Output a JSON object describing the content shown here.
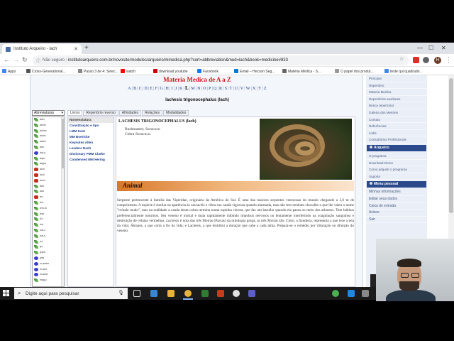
{
  "browser": {
    "tab_title": "Instituto Arqueiro - lach",
    "not_secure": "Não seguro",
    "url": "institutoarqueiro.com.br/novosite/modules/arqueiro/mmedica.php?sort=abbreviation&med=lach&book=medicine#833",
    "profile_initial": "H"
  },
  "bookmarks": [
    {
      "label": "Apps",
      "color": "#4285f4"
    },
    {
      "label": "Cross-Generational...",
      "color": "#555"
    },
    {
      "label": "Passo 3 de 4: Selec...",
      "color": "#888"
    },
    {
      "label": "watch",
      "color": "#ff0000"
    },
    {
      "label": "download youtube",
      "color": "#c00"
    },
    {
      "label": "Facebook",
      "color": "#1877f2"
    },
    {
      "label": "Email – Hecson Seg...",
      "color": "#0078d4"
    },
    {
      "label": "Matéria Médica - S...",
      "color": "#666"
    },
    {
      "label": "O papel dos produt...",
      "color": "#999"
    },
    {
      "label": "teste qui quadrado...",
      "color": "#4285f4"
    }
  ],
  "site": {
    "title": "Materia Medica de A a Z",
    "alphabet": [
      "A",
      "B",
      "C",
      "D",
      "E",
      "F",
      "G",
      "H",
      "I",
      "J",
      "K",
      "L",
      "M",
      "N",
      "O",
      "P",
      "Q",
      "R",
      "S",
      "T",
      "U",
      "V",
      "W",
      "X",
      "Y",
      "Z"
    ],
    "current_letter": "L",
    "remedy_heading": "lachesis trigonocephalus (lach)"
  },
  "select": {
    "value": "Abreviaturas"
  },
  "tabs": [
    "Livros",
    "Repertório reverso",
    "Afinidades",
    "Relações",
    "Modalidades"
  ],
  "remedy_list": [
    {
      "label": "lach",
      "icon": "leaf"
    },
    {
      "label": "lachn",
      "icon": "leaf"
    },
    {
      "label": "lachm",
      "icon": "leaf"
    },
    {
      "label": "lachs",
      "icon": "leaf"
    },
    {
      "label": "lactm",
      "icon": "leaf"
    },
    {
      "label": "lam",
      "icon": "leaf"
    },
    {
      "label": "lap-a",
      "icon": "gem"
    },
    {
      "label": "lapa",
      "icon": "leaf"
    },
    {
      "label": "lappa",
      "icon": "leaf"
    },
    {
      "label": "lat-h",
      "icon": "butterfly"
    },
    {
      "label": "lat-k",
      "icon": "butterfly"
    },
    {
      "label": "lat-m",
      "icon": "butterfly"
    },
    {
      "label": "lath",
      "icon": "leaf"
    },
    {
      "label": "laur",
      "icon": "leaf"
    },
    {
      "label": "lec",
      "icon": "butterfly"
    },
    {
      "label": "led",
      "icon": "leaf"
    },
    {
      "label": "lem-m",
      "icon": "leaf"
    },
    {
      "label": "lept",
      "icon": "leaf"
    },
    {
      "label": "lil-t",
      "icon": "leaf"
    },
    {
      "label": "lob",
      "icon": "leaf"
    },
    {
      "label": "lob-c",
      "icon": "leaf"
    },
    {
      "label": "lob-s",
      "icon": "leaf"
    },
    {
      "label": "lol",
      "icon": "leaf"
    },
    {
      "label": "lyc",
      "icon": "leaf"
    },
    {
      "label": "lycps",
      "icon": "leaf"
    },
    {
      "label": "lyss",
      "icon": "gem"
    },
    {
      "label": "m-ambo",
      "icon": "gem"
    },
    {
      "label": "m-arct",
      "icon": "gem"
    },
    {
      "label": "m-aust",
      "icon": "gem"
    },
    {
      "label": "mag-c",
      "icon": "leaf"
    }
  ],
  "menu": [
    "Nomenclatura",
    "Constituição e tipo",
    "LMM Kent",
    "MM Boericke",
    "Keynotes Allen",
    "Leaders Nash",
    "Dictionary PMM Clarke",
    "Condensed MM Hering"
  ],
  "article": {
    "title": "LACHESIS TRIGONOCEPHALUS (lach)",
    "common_names": [
      "Bushmaster; Surucucu",
      "Cobra Surucucu."
    ],
    "section": "Animal",
    "body_1": "Serpente pertencente à família das Viperidae, originária da América do Sul. É uma das maiores serpentes venenosas do mundo chegando a 3,6 m de comprimento. A espécie é similar na aparência às cascavéis e vibra sua cauda vigorosa quando alarmada, mas não tem nenhum chocalho o que lhe valeu o nome \"crótalo mudo\", mas na realidade a cauda desta cobra termina numa espinha córnea, que faz um barulho quando ela passa no meio dos arbustos. Tem hábitos preferencialmente noturnos. Seu veneno é mortal e mata rapidamente inibindo impulsos nervosos ou lentamente interferindo na coagulação sanguínea e destruição de células vermelhas. ",
    "body_italic": "Lachesis",
    "body_2": " é uma das três Moiras (Parcas) da mitologia grega; as três Moiras são: Cloto, a fiandeira, representa a que tece a teia da vida; Átropos, a que corta o fio da vida; e Lachesis, a que distribui a duração que cabe a cada alma. Prepara-se o remédio por trituração ou diluição do veneno."
  },
  "right_menu": {
    "top_links": [
      "Principal",
      "Repertório",
      "Materia Medica",
      "Repertórios auxiliares",
      "Busca repertorial",
      "Galeria dos Mestres",
      "Contato",
      "Referências",
      "Links",
      "Consultórios Profissionais"
    ],
    "arqueiro_header": "Arqueiro",
    "arqueiro_links": [
      "O programa",
      "Download Demo",
      "Como adquirir o programa",
      "Suporte"
    ],
    "personal_header": "Menu pessoal",
    "personal_links": [
      "Minhas informações",
      "Editar seus dados",
      "Caixa de entrada",
      "Avisos",
      "Sair"
    ]
  },
  "taskbar": {
    "search_placeholder": "Digite aqui para pesquisar"
  }
}
